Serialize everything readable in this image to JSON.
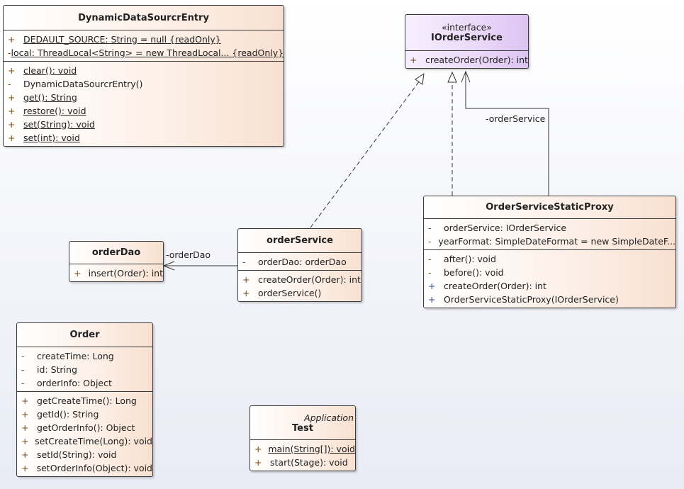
{
  "classes": [
    {
      "id": "dynamic",
      "title": "DynamicDataSourcrEntry",
      "stereotype": "",
      "parent": "",
      "attributes": [
        {
          "vis": "+",
          "text": "DEDAULT_SOURCE: String = null {readOnly}",
          "static": true
        },
        {
          "vis": "-",
          "text": "local: ThreadLocal<String> = new ThreadLocal... {readOnly}",
          "static": true
        }
      ],
      "methods": [
        {
          "vis": "+",
          "text": "clear(): void",
          "static": true
        },
        {
          "vis": "-",
          "text": "DynamicDataSourcrEntry()",
          "static": false
        },
        {
          "vis": "+",
          "text": "get(): String",
          "static": true
        },
        {
          "vis": "+",
          "text": "restore(): void",
          "static": true
        },
        {
          "vis": "+",
          "text": "set(String): void",
          "static": true
        },
        {
          "vis": "+",
          "text": "set(int): void",
          "static": true
        }
      ]
    },
    {
      "id": "iorderservice",
      "title": "IOrderService",
      "stereotype": "«interface»",
      "parent": "",
      "interface": true,
      "attributes": [],
      "methods": [
        {
          "vis": "+",
          "text": "createOrder(Order): int",
          "static": false
        }
      ]
    },
    {
      "id": "orderdao",
      "title": "orderDao",
      "stereotype": "",
      "parent": "",
      "attributes": [],
      "methods": [
        {
          "vis": "+",
          "text": "insert(Order): int",
          "static": false
        }
      ]
    },
    {
      "id": "orderservice",
      "title": "orderService",
      "stereotype": "",
      "parent": "",
      "attributes": [
        {
          "vis": "-",
          "text": "orderDao: orderDao",
          "static": false
        }
      ],
      "methods": [
        {
          "vis": "+",
          "text": "createOrder(Order): int",
          "static": false
        },
        {
          "vis": "+",
          "text": "orderService()",
          "static": false
        }
      ]
    },
    {
      "id": "proxy",
      "title": "OrderServiceStaticProxy",
      "stereotype": "",
      "parent": "",
      "attributes": [
        {
          "vis": "-",
          "text": "orderService: IOrderService",
          "static": false
        },
        {
          "vis": "-",
          "text": "yearFormat: SimpleDateFormat = new SimpleDateF...",
          "static": false
        }
      ],
      "methods": [
        {
          "vis": "-",
          "text": "after(): void",
          "static": false
        },
        {
          "vis": "-",
          "text": "before(): void",
          "static": false
        },
        {
          "vis": "+",
          "text": "createOrder(Order): int",
          "static": false
        },
        {
          "vis": "+",
          "text": "OrderServiceStaticProxy(IOrderService)",
          "static": false
        }
      ]
    },
    {
      "id": "order",
      "title": "Order",
      "stereotype": "",
      "parent": "",
      "attributes": [
        {
          "vis": "-",
          "text": "createTime: Long",
          "static": false
        },
        {
          "vis": "-",
          "text": "id: String",
          "static": false
        },
        {
          "vis": "-",
          "text": "orderInfo: Object",
          "static": false
        }
      ],
      "methods": [
        {
          "vis": "+",
          "text": "getCreateTime(): Long",
          "static": false
        },
        {
          "vis": "+",
          "text": "getId(): String",
          "static": false
        },
        {
          "vis": "+",
          "text": "getOrderInfo(): Object",
          "static": false
        },
        {
          "vis": "+",
          "text": "setCreateTime(Long): void",
          "static": false
        },
        {
          "vis": "+",
          "text": "setId(String): void",
          "static": false
        },
        {
          "vis": "+",
          "text": "setOrderInfo(Object): void",
          "static": false
        }
      ]
    },
    {
      "id": "test",
      "title": "Test",
      "stereotype": "",
      "parent": "Application",
      "attributes": [],
      "methods": [
        {
          "vis": "+",
          "text": "main(String[]): void",
          "static": true
        },
        {
          "vis": "+",
          "text": "start(Stage): void",
          "static": false
        }
      ]
    }
  ],
  "relations": [
    {
      "type": "realization",
      "from": "orderService",
      "to": "IOrderService"
    },
    {
      "type": "realization",
      "from": "OrderServiceStaticProxy",
      "to": "IOrderService"
    },
    {
      "type": "association",
      "from": "OrderServiceStaticProxy",
      "to": "IOrderService",
      "label": "-orderService"
    },
    {
      "type": "association",
      "from": "orderService",
      "to": "orderDao",
      "label": "-orderDao"
    }
  ],
  "colors": {
    "class_fill": "#f8e0d0",
    "interface_fill": "#dcc4f2",
    "border": "#3a3a3a",
    "vis_brown": "#7a4a10",
    "vis_blue": "#1f3f8f"
  }
}
